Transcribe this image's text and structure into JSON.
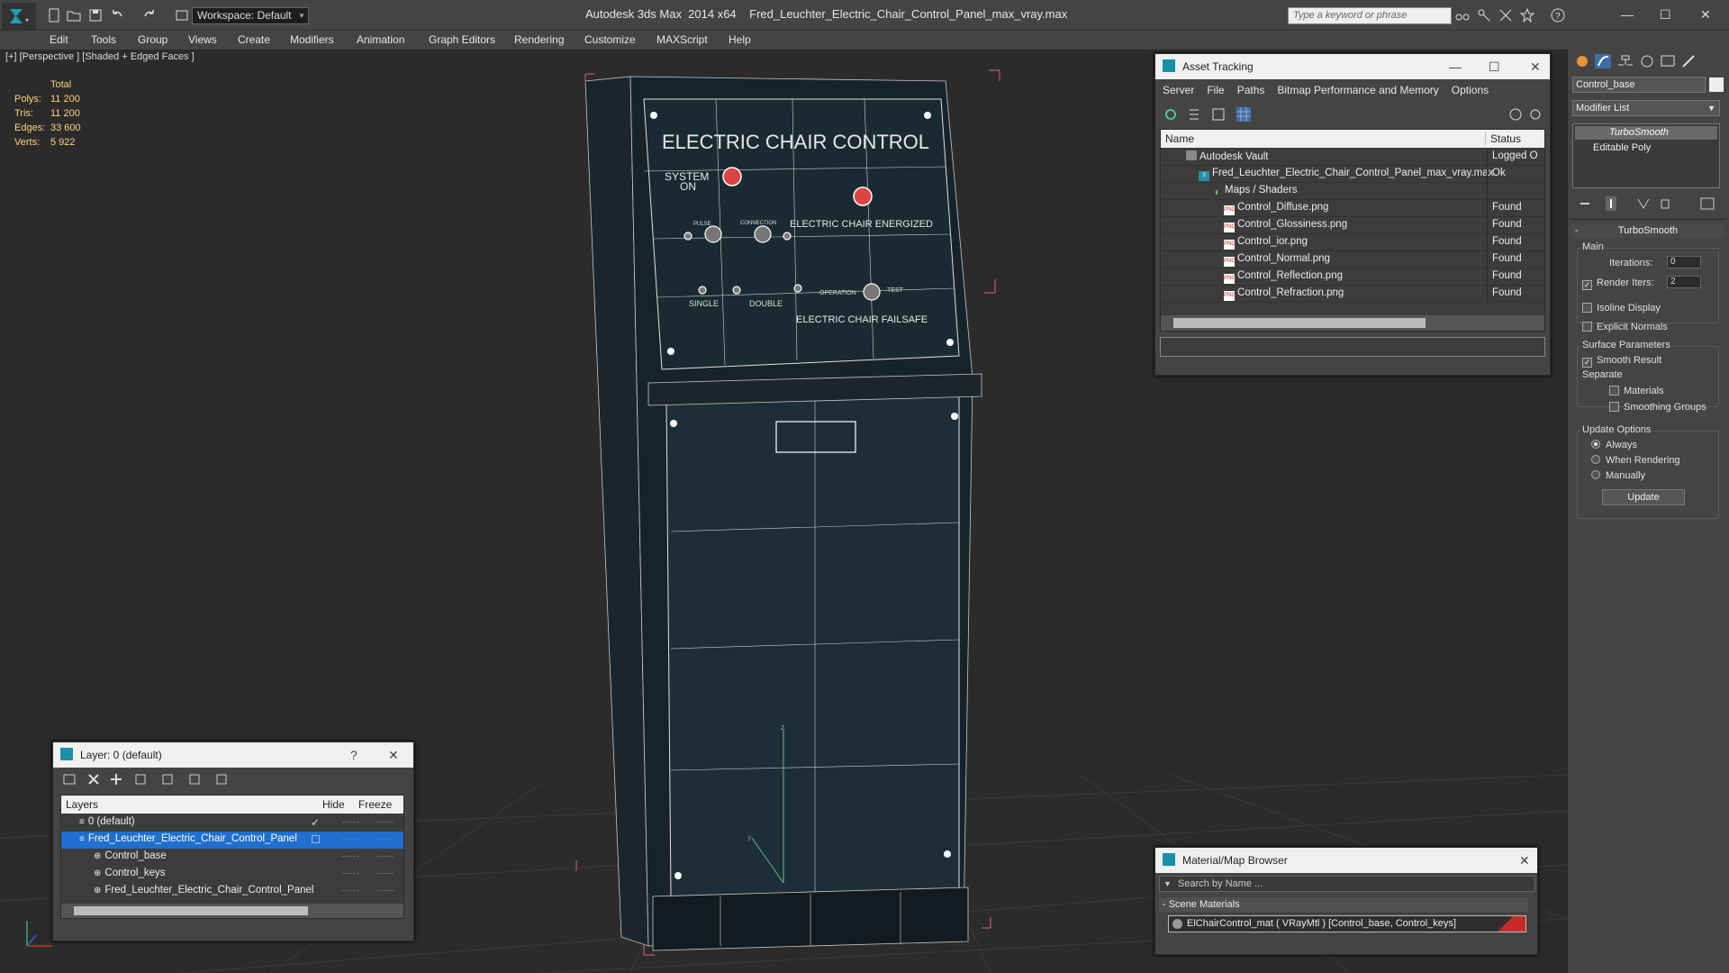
{
  "app": {
    "title": "Autodesk 3ds Max  2014 x64",
    "filename": "Fred_Leuchter_Electric_Chair_Control_Panel_max_vray.max",
    "workspace": "Workspace: Default",
    "search_placeholder": "Type a keyword or phrase"
  },
  "menu": [
    "Edit",
    "Tools",
    "Group",
    "Views",
    "Create",
    "Modifiers",
    "Animation",
    "Graph Editors",
    "Rendering",
    "Customize",
    "MAXScript",
    "Help"
  ],
  "viewport": {
    "label": "[+] [Perspective ] [Shaded + Edged Faces ]",
    "stats": {
      "header": "Total",
      "rows": [
        {
          "k": "Polys:",
          "v": "11 200"
        },
        {
          "k": "Tris:",
          "v": "11 200"
        },
        {
          "k": "Edges:",
          "v": "33 600"
        },
        {
          "k": "Verts:",
          "v": "5 922"
        }
      ]
    },
    "model_text": {
      "title": "ELECTRIC CHAIR CONTROL",
      "system": "SYSTEM",
      "on": "ON",
      "energized": "ELECTRIC CHAIR ENERGIZED",
      "failsafe": "ELECTRIC CHAIR FAILSAFE",
      "single": "SINGLE",
      "double": "DOUBLE",
      "operation": "OPERATION",
      "test": "TEST",
      "pulse": "PULSE",
      "connection": "CONNECTION",
      "axis_z": "z",
      "axis_y": "y"
    }
  },
  "asset_tracking": {
    "title": "Asset Tracking",
    "menu": [
      "Server",
      "File",
      "Paths",
      "Bitmap Performance and Memory",
      "Options"
    ],
    "col_name": "Name",
    "col_status": "Status",
    "rows": [
      {
        "name": "Autodesk Vault",
        "status": "Logged O",
        "indent": 0,
        "type": "vault"
      },
      {
        "name": "Fred_Leuchter_Electric_Chair_Control_Panel_max_vray.max",
        "status": "Ok",
        "indent": 1,
        "type": "max"
      },
      {
        "name": "Maps / Shaders",
        "status": "",
        "indent": 2,
        "type": "folder"
      },
      {
        "name": "Control_Diffuse.png",
        "status": "Found",
        "indent": 3,
        "type": "png"
      },
      {
        "name": "Control_Glossiness.png",
        "status": "Found",
        "indent": 3,
        "type": "png"
      },
      {
        "name": "Control_ior.png",
        "status": "Found",
        "indent": 3,
        "type": "png"
      },
      {
        "name": "Control_Normal.png",
        "status": "Found",
        "indent": 3,
        "type": "png"
      },
      {
        "name": "Control_Reflection.png",
        "status": "Found",
        "indent": 3,
        "type": "png"
      },
      {
        "name": "Control_Refraction.png",
        "status": "Found",
        "indent": 3,
        "type": "png"
      }
    ]
  },
  "layer": {
    "title": "Layer: 0 (default)",
    "help": "?",
    "col_layers": "Layers",
    "col_hide": "Hide",
    "col_freeze": "Freeze",
    "rows": [
      {
        "name": "0 (default)",
        "indent": 0,
        "selected": false,
        "check": true
      },
      {
        "name": "Fred_Leuchter_Electric_Chair_Control_Panel",
        "indent": 0,
        "selected": true,
        "check": false
      },
      {
        "name": "Control_base",
        "indent": 1,
        "selected": false,
        "check": false
      },
      {
        "name": "Control_keys",
        "indent": 1,
        "selected": false,
        "check": false
      },
      {
        "name": "Fred_Leuchter_Electric_Chair_Control_Panel",
        "indent": 1,
        "selected": false,
        "check": false
      }
    ],
    "dots": "-----"
  },
  "material_browser": {
    "title": "Material/Map Browser",
    "search_placeholder": "Search by Name ...",
    "section": "- Scene Materials",
    "item": "ElChairControl_mat  ( VRayMtl )  [Control_base, Control_keys]"
  },
  "command_panel": {
    "object_name": "Control_base",
    "modifier_list": "Modifier List",
    "stack": [
      "TurboSmooth",
      "Editable Poly"
    ],
    "rollout_title": "TurboSmooth",
    "main": "Main",
    "iterations_label": "Iterations:",
    "iterations": "0",
    "render_iters_label": "Render Iters:",
    "render_iters": "2",
    "isoline": "Isoline Display",
    "explicit_normals": "Explicit Normals",
    "surface_params": "Surface Parameters",
    "smooth_result": "Smooth Result",
    "separate": "Separate",
    "materials": "Materials",
    "smoothing_groups": "Smoothing Groups",
    "update_options": "Update Options",
    "always": "Always",
    "when_rendering": "When Rendering",
    "manually": "Manually",
    "update_button": "Update"
  }
}
